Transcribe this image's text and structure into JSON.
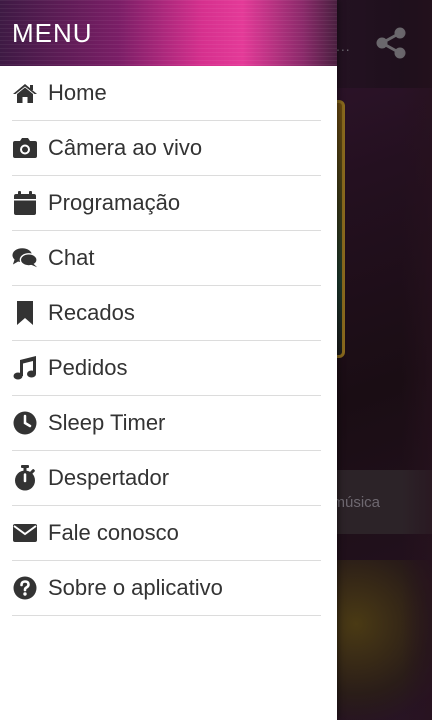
{
  "drawer": {
    "title": "MENU",
    "items": [
      {
        "label": "Home",
        "icon": "home-icon"
      },
      {
        "label": "Câmera ao vivo",
        "icon": "camera-icon"
      },
      {
        "label": "Programação",
        "icon": "calendar-icon"
      },
      {
        "label": "Chat",
        "icon": "chat-icon"
      },
      {
        "label": "Recados",
        "icon": "bookmark-icon"
      },
      {
        "label": "Pedidos",
        "icon": "music-note-icon"
      },
      {
        "label": "Sleep Timer",
        "icon": "clock-icon"
      },
      {
        "label": "Despertador",
        "icon": "stopwatch-icon"
      },
      {
        "label": "Fale conosco",
        "icon": "envelope-icon"
      },
      {
        "label": "Sobre o aplicativo",
        "icon": "question-circle-icon"
      }
    ]
  },
  "background": {
    "truncated_text": "a música",
    "ellipsis": "..."
  },
  "colors": {
    "drawer_bg": "#ffffff",
    "header_accent": "#e43a98",
    "icon": "#333333",
    "divider": "#dcdcdc"
  }
}
